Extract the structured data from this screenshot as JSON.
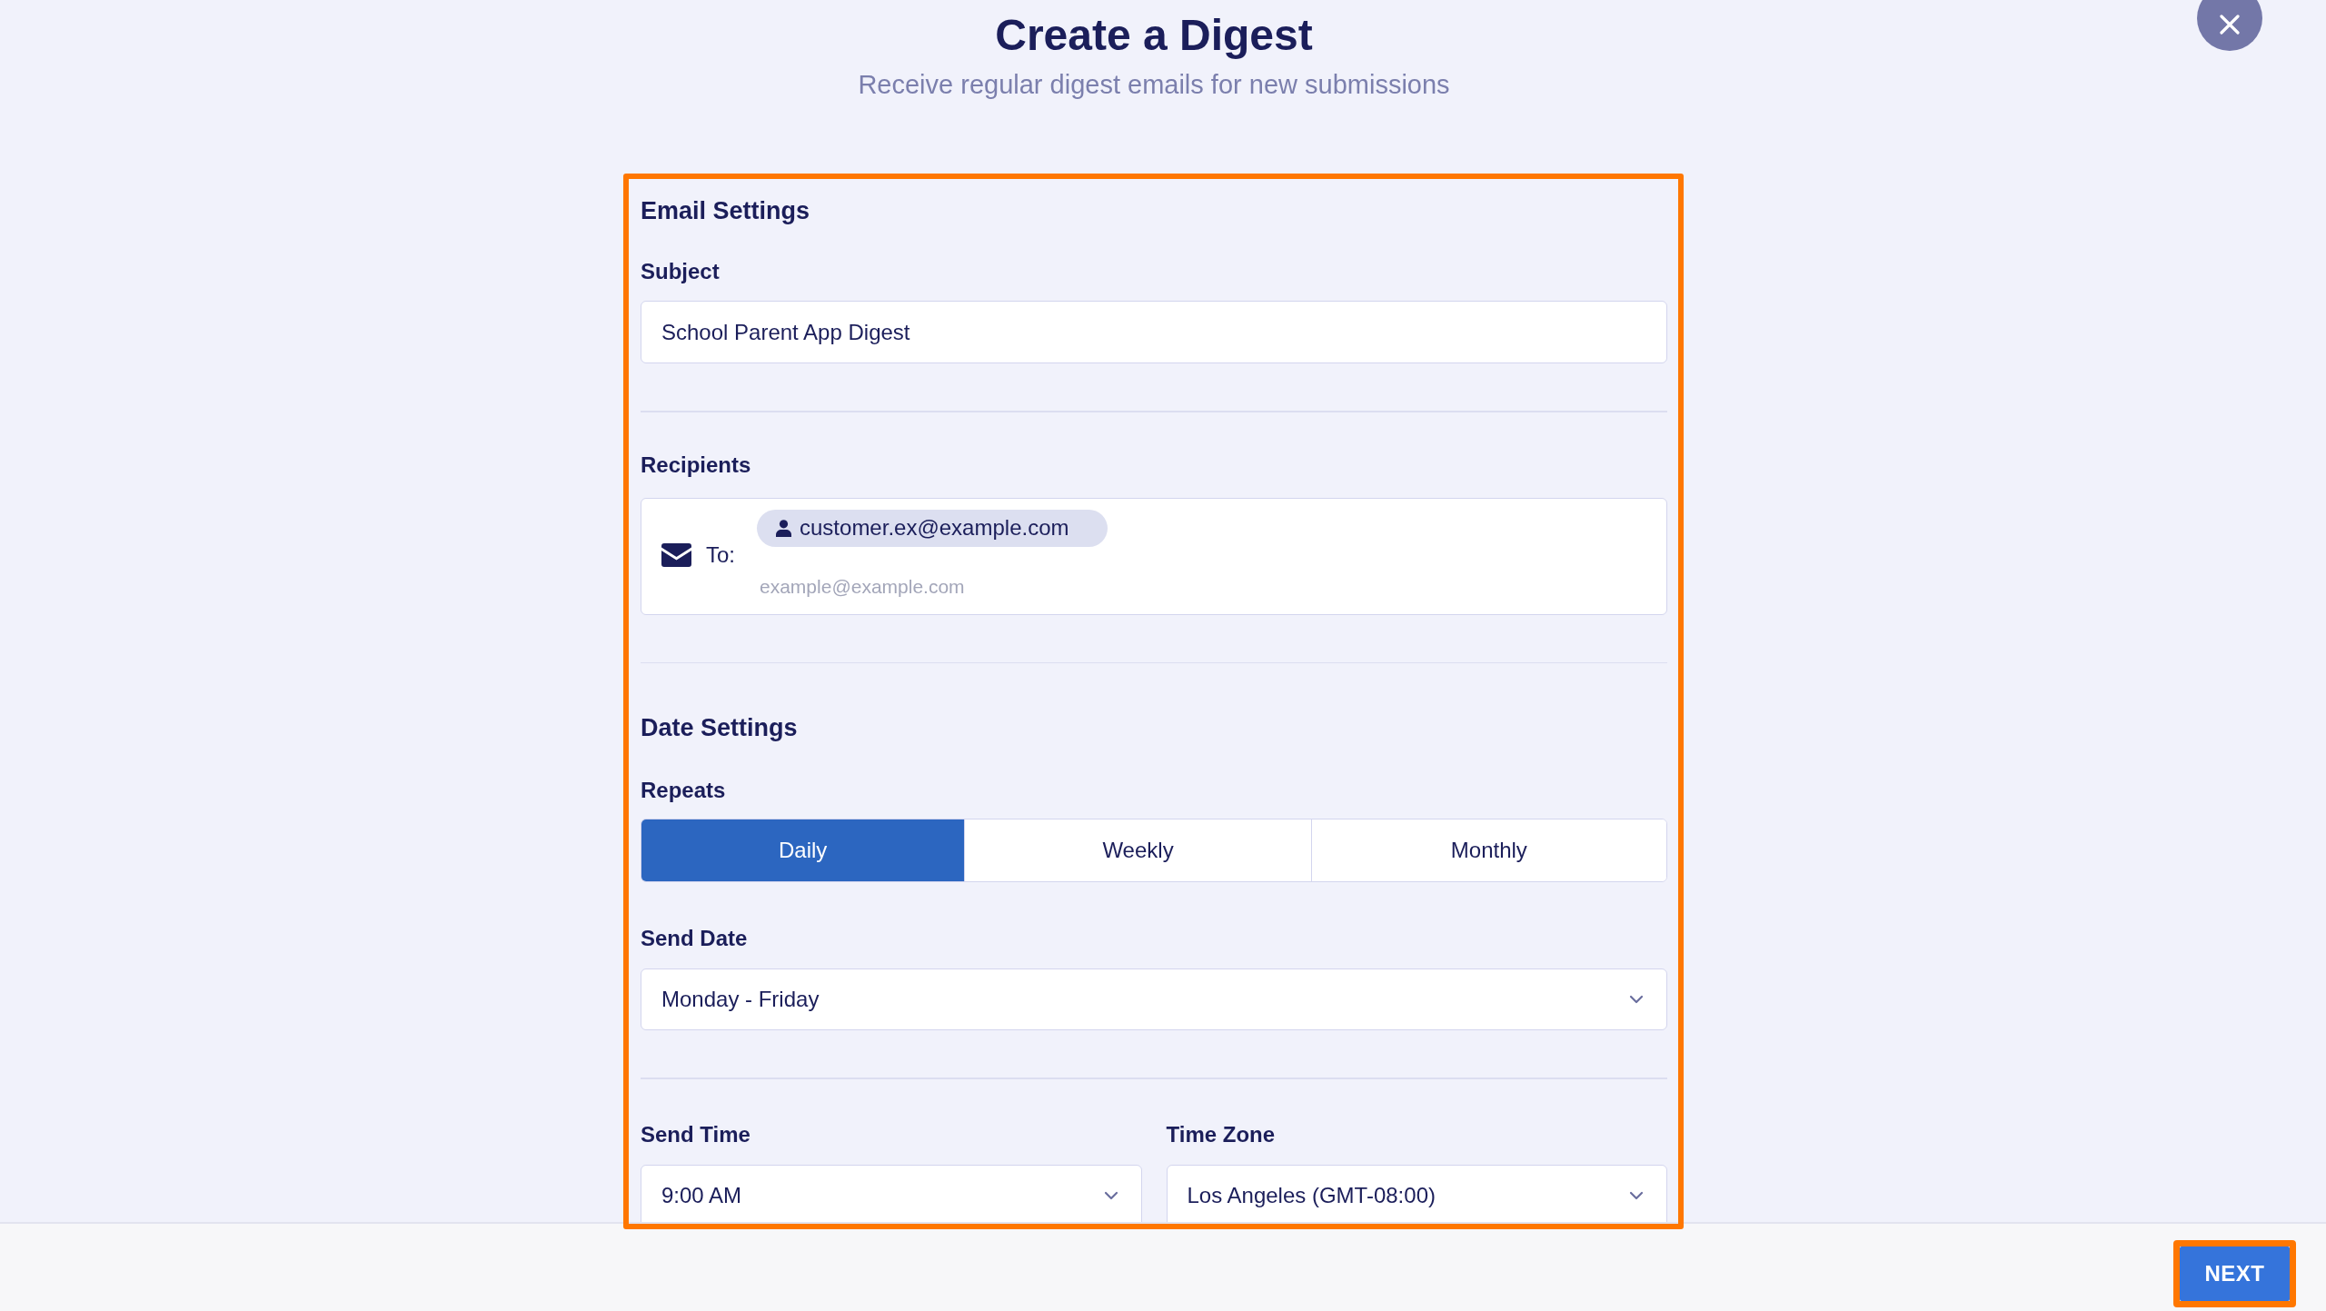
{
  "header": {
    "title": "Create a Digest",
    "subtitle": "Receive regular digest emails for new submissions"
  },
  "form": {
    "highlighted": true,
    "email_settings": {
      "heading": "Email Settings",
      "subject": {
        "label": "Subject",
        "value": "School Parent App Digest"
      },
      "recipients": {
        "label": "Recipients",
        "to_label": "To:",
        "chips": [
          "customer.ex@example.com"
        ],
        "placeholder": "example@example.com"
      }
    },
    "date_settings": {
      "heading": "Date Settings",
      "repeats": {
        "label": "Repeats",
        "options": [
          {
            "label": "Daily",
            "selected": true
          },
          {
            "label": "Weekly",
            "selected": false
          },
          {
            "label": "Monthly",
            "selected": false
          }
        ]
      },
      "send_date": {
        "label": "Send Date",
        "value": "Monday - Friday"
      },
      "send_time": {
        "label": "Send Time",
        "value": "9:00 AM"
      },
      "time_zone": {
        "label": "Time Zone",
        "value": "Los Angeles (GMT-08:00)"
      }
    }
  },
  "footer": {
    "next_button": {
      "label": "NEXT",
      "highlighted": true
    }
  }
}
